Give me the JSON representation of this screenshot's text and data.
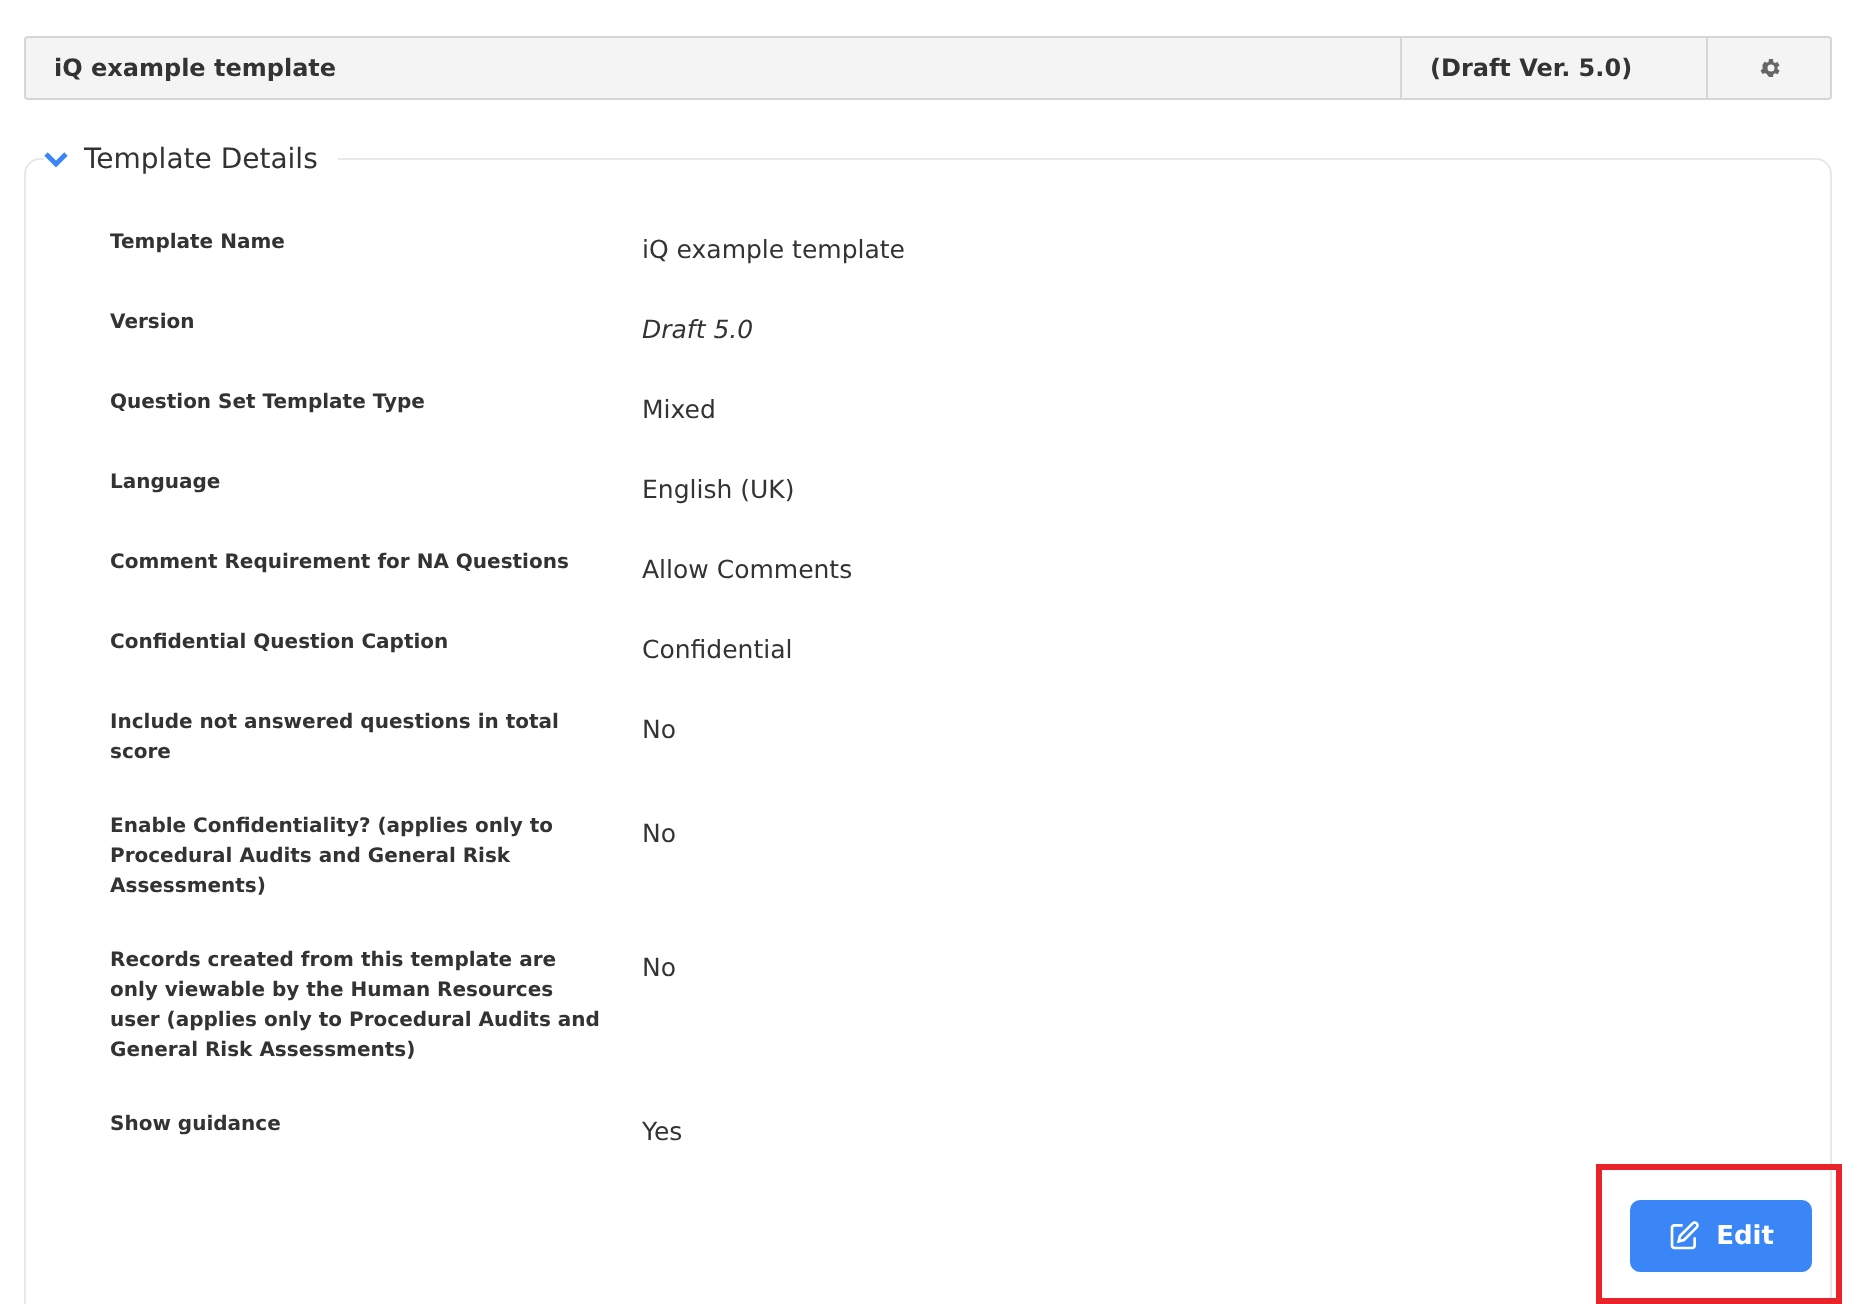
{
  "header": {
    "title": "iQ example template",
    "version": "(Draft Ver. 5.0)"
  },
  "section": {
    "title": "Template Details",
    "expanded": true,
    "rows": [
      {
        "label": "Template Name",
        "value": "iQ example template",
        "italic": false
      },
      {
        "label": "Version",
        "value": "Draft 5.0",
        "italic": true
      },
      {
        "label": "Question Set Template Type",
        "value": "Mixed",
        "italic": false
      },
      {
        "label": "Language",
        "value": "English (UK)",
        "italic": false
      },
      {
        "label": "Comment Requirement for NA Questions",
        "value": "Allow Comments",
        "italic": false
      },
      {
        "label": "Confidential Question Caption",
        "value": "Confidential",
        "italic": false
      },
      {
        "label": "Include not answered questions in total score",
        "value": "No",
        "italic": false
      },
      {
        "label": "Enable Confidentiality? (applies only to Procedural Audits and General Risk Assessments)",
        "value": "No",
        "italic": false
      },
      {
        "label": "Records created from this template are only viewable by the Human Resources user (applies only to Procedural Audits and General Risk Assessments)",
        "value": "No",
        "italic": false
      },
      {
        "label": "Show guidance",
        "value": "Yes",
        "italic": false
      }
    ]
  },
  "edit_button": {
    "label": "Edit",
    "highlighted": true
  }
}
